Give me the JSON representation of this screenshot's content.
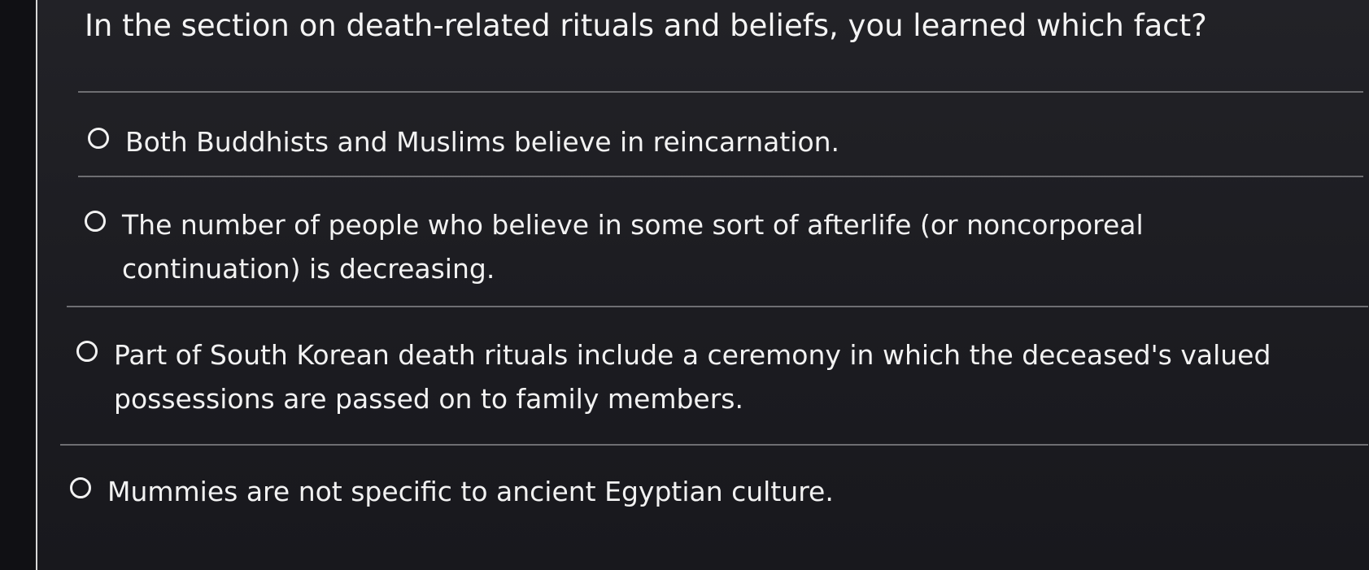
{
  "question": {
    "text": "In the section on death-related rituals and beliefs, you learned which fact?"
  },
  "options": [
    {
      "label": "Both Buddhists and Muslims believe in reincarnation.",
      "selected": false
    },
    {
      "label": "The number of people who believe in some sort of afterlife (or noncorporeal continuation) is decreasing.",
      "selected": false
    },
    {
      "label": "Part of South Korean death rituals include a ceremony in which the deceased's valued possessions are passed on to family members.",
      "selected": false
    },
    {
      "label": "Mummies are not specific to ancient Egyptian culture.",
      "selected": false
    }
  ]
}
